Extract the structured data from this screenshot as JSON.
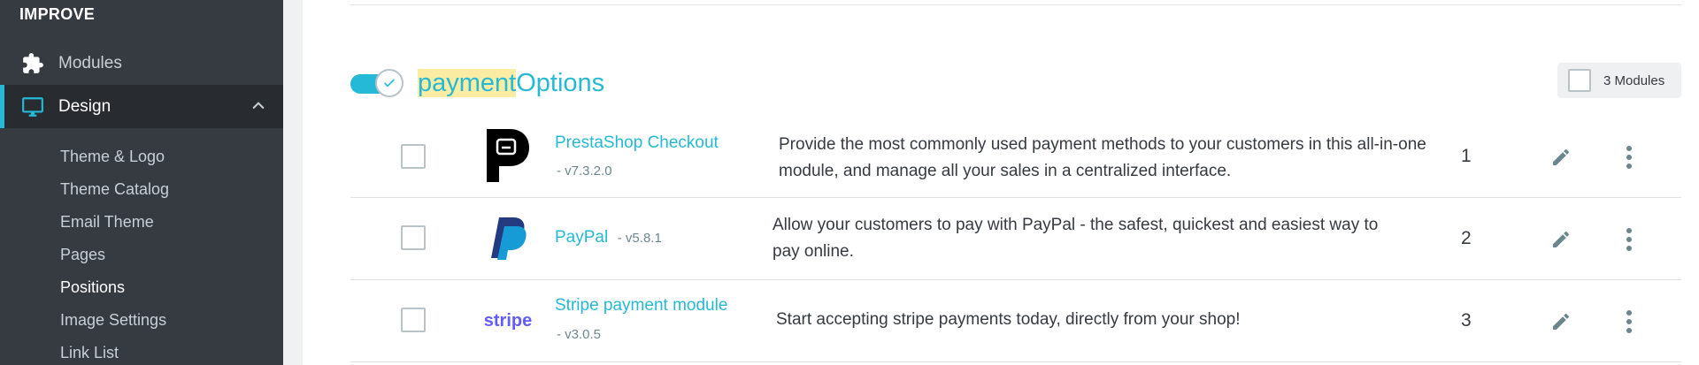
{
  "sidebar": {
    "section": "IMPROVE",
    "modules_label": "Modules",
    "design_label": "Design",
    "sub_items": [
      "Theme & Logo",
      "Theme Catalog",
      "Email Theme",
      "Pages",
      "Positions",
      "Image Settings",
      "Link List"
    ],
    "active_sub": "Positions",
    "colors": {
      "bg": "#363a41",
      "active_bg": "#282b30",
      "accent": "#25b9d7"
    }
  },
  "hook": {
    "title_highlight": "payment",
    "title_rest": "Options",
    "enabled": true,
    "count_label": "3 Modules"
  },
  "modules": [
    {
      "name": "PrestaShop Checkout",
      "version": "- v7.3.2.0",
      "description": "Provide the most commonly used payment methods to your customers in this all-in-one module, and manage all your sales in a centralized interface.",
      "position": "1",
      "icon": "prestashop-checkout-logo"
    },
    {
      "name": "PayPal",
      "version": "- v5.8.1",
      "description": "Allow your customers to pay with PayPal - the safest, quickest and easiest way to pay online.",
      "position": "2",
      "icon": "paypal-logo"
    },
    {
      "name": "Stripe payment module",
      "version": "- v3.0.5",
      "description": "Start accepting stripe payments today, directly from your shop!",
      "position": "3",
      "icon": "stripe-logo",
      "logo_text": "stripe"
    }
  ]
}
